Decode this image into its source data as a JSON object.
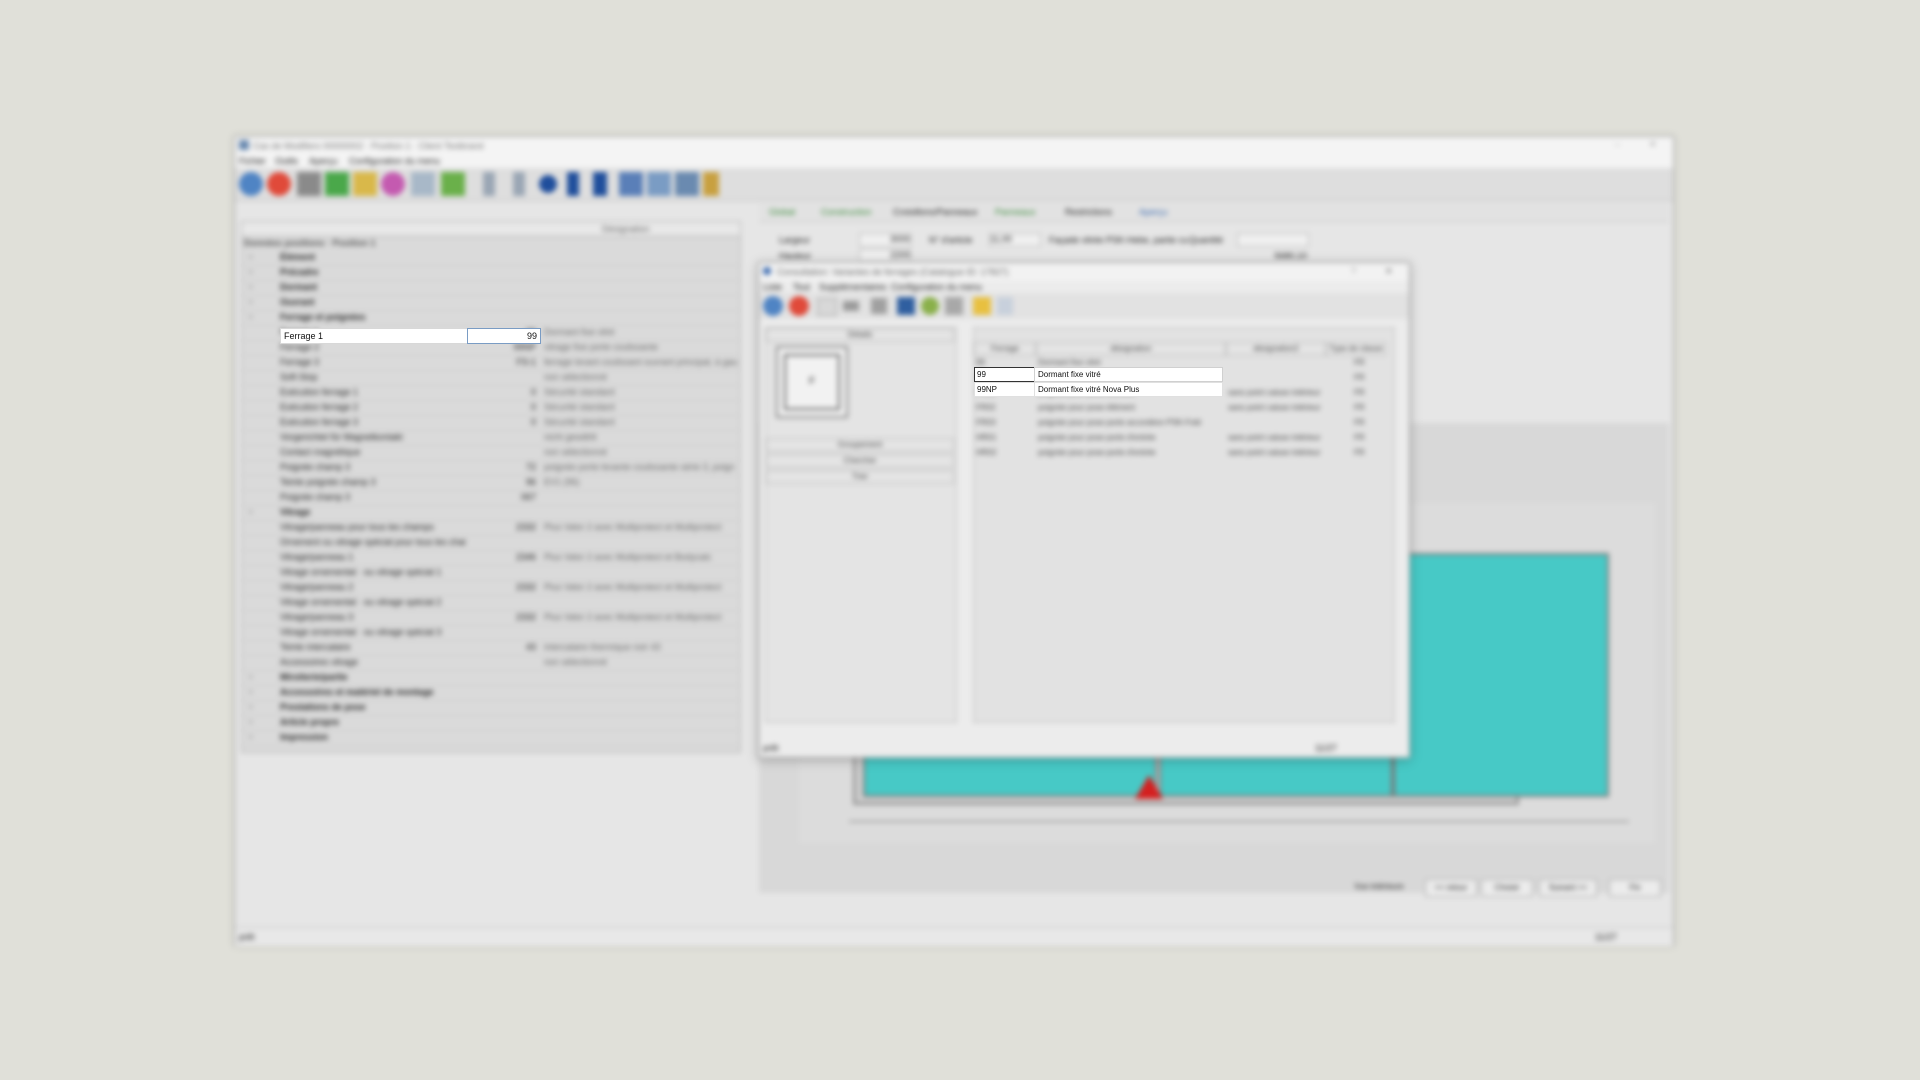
{
  "titlebar": {
    "title": "Cas de Modifiers 00000002 · Position 1 · Client Testbrand"
  },
  "menu": [
    "Fichier",
    "Outils",
    "Aperçu",
    "Configuration du menu"
  ],
  "toolbar_icons": [
    "blue-globe-icon",
    "red-circle-icon",
    "hammer-icon",
    "arrow-green-icon",
    "pencil-icon",
    "palette-icon",
    "copy-icon",
    "tree-icon",
    "first-icon",
    "prev-icon",
    "record-icon",
    "next-icon",
    "last-icon",
    "window-icon",
    "image-icon",
    "grid-icon",
    "key-icon"
  ],
  "left": {
    "header": {
      "col3": "Désignation"
    },
    "group_title": "Données positions · Position 1",
    "rows": [
      {
        "label": "Élément",
        "value": "",
        "desc": "",
        "group": true
      },
      {
        "label": "Précadre",
        "value": "",
        "desc": "",
        "group": true
      },
      {
        "label": "Dormant",
        "value": "",
        "desc": "",
        "group": true
      },
      {
        "label": "Ouvrant",
        "value": "",
        "desc": "",
        "group": true
      },
      {
        "label": "Ferrage et poignées",
        "value": "",
        "desc": "",
        "group": true
      },
      {
        "label": "Ferrage 1",
        "value": "99",
        "desc": "Dormant fixe vitré",
        "group": false
      },
      {
        "label": "Ferrage 2",
        "value": "99NP",
        "desc": "vitrage fixe porte coulissante",
        "group": false
      },
      {
        "label": "Ferrage 3",
        "value": "FS-1",
        "desc": "ferrage levant coulissant ouvrant principal, à gau",
        "group": false
      },
      {
        "label": "Soft-Stop",
        "value": "",
        "desc": "non sélectionné",
        "group": false
      },
      {
        "label": "Exécution ferrage 1",
        "value": "0",
        "desc": "Sécurité standard",
        "group": false
      },
      {
        "label": "Exécution ferrage 2",
        "value": "0",
        "desc": "Sécurité standard",
        "group": false
      },
      {
        "label": "Exécution ferrage 3",
        "value": "0",
        "desc": "Sécurité standard",
        "group": false
      },
      {
        "label": "Vorgerichtet für Magnetkontakt",
        "value": "",
        "desc": "nicht gewählt",
        "group": false
      },
      {
        "label": "Contact magnétique",
        "value": "",
        "desc": "non sélectionné",
        "group": false
      },
      {
        "label": "Poignée champ 3",
        "value": "72",
        "desc": "poignée porte levante coulissante série 3, poign",
        "group": false
      },
      {
        "label": "Teinte poignée champ 3",
        "value": "96",
        "desc": "EV1 (96)",
        "group": false
      },
      {
        "label": "Poignée champ 3",
        "value": "067",
        "desc": "",
        "group": false
      },
      {
        "label": "Vitrage",
        "value": "",
        "desc": "",
        "group": true
      },
      {
        "label": "Vitrage/panneau pour tous les champs",
        "value": "2332",
        "desc": "Plus Valor 2 avec Multiprotect et Multiprotect",
        "group": false
      },
      {
        "label": "Ornement ou vitrage spécial pour tous les chain",
        "value": "",
        "desc": "",
        "group": false
      },
      {
        "label": "Vitrage/panneau 1",
        "value": "2346",
        "desc": "Plus Valor 2 avec Multiprotect et Bodycalc",
        "group": false
      },
      {
        "label": "Vitrage ornemental · ou vitrage spécial 1",
        "value": "",
        "desc": "",
        "group": false
      },
      {
        "label": "Vitrage/panneau 2",
        "value": "2332",
        "desc": "Plus Valor 2 avec Multiprotect et Multiprotect",
        "group": false
      },
      {
        "label": "Vitrage ornemental · ou vitrage spécial 2",
        "value": "",
        "desc": "",
        "group": false
      },
      {
        "label": "Vitrage/panneau 3",
        "value": "2332",
        "desc": "Plus Valor 2 avec Multiprotect et Multiprotect",
        "group": false
      },
      {
        "label": "Vitrage ornemental · ou vitrage spécial 3",
        "value": "",
        "desc": "",
        "group": false
      },
      {
        "label": "Teinte intercalaire",
        "value": "43",
        "desc": "intercalaire thermique noir 43",
        "group": false
      },
      {
        "label": "Accessoires vitrage",
        "value": "",
        "desc": "non sélectionné",
        "group": false
      },
      {
        "label": "Miroiterie/partie",
        "value": "",
        "desc": "",
        "group": true
      },
      {
        "label": "Accessoires et matériel de montage",
        "value": "",
        "desc": "",
        "group": true
      },
      {
        "label": "Prestations de pose",
        "value": "",
        "desc": "",
        "group": true
      },
      {
        "label": "Article propre",
        "value": "",
        "desc": "",
        "group": true
      },
      {
        "label": "Impression",
        "value": "",
        "desc": "",
        "group": true
      }
    ]
  },
  "right": {
    "tabs": [
      "Global",
      "Construction",
      "Croisillons/Panneaux",
      "Panneaux",
      "Restrictions",
      "Aperçu"
    ],
    "fields": [
      {
        "label": "Largeur",
        "value": "3000"
      },
      {
        "label": "Hauteur",
        "value": "2200"
      },
      {
        "label": "N° d'article",
        "value": "11,00"
      },
      {
        "label": "Quantité",
        "value": ""
      }
    ],
    "desc_text": "Façade vitrée PSK-Hebe, partie cu",
    "price": "5680,10"
  },
  "dialog": {
    "title": "Consultation: Variantes de ferrages (Catalogue ID: 17827)",
    "menu": [
      "Liste",
      "Tout",
      "Supplémentaires",
      "Configuration du menu"
    ],
    "left_header": "Détails",
    "left_items": [
      "Groupement",
      "Chercher",
      "Trier"
    ],
    "preview_letter": "F",
    "columns": [
      "Ferrage",
      "désignation",
      "désignation2",
      "Type de classe"
    ],
    "rows": [
      {
        "code": "99",
        "name": "Dormant fixe vitré",
        "name2": "",
        "type": "FR"
      },
      {
        "code": "99NP",
        "name": "Dormant fixe vitré Nova Plus",
        "name2": "",
        "type": "FR"
      },
      {
        "code": "FR01",
        "name": "poignée pour pose élément",
        "name2": "sans point caisse intérieur",
        "type": "FR"
      },
      {
        "code": "FR02",
        "name": "poignée pour pose élément",
        "name2": "sans point caisse intérieur",
        "type": "FR"
      },
      {
        "code": "FR03",
        "name": "poignée pour pose porte accordéon PSK-Fold",
        "name2": "",
        "type": "FR"
      },
      {
        "code": "HR01",
        "name": "poignée pour pose porte d'entrée",
        "name2": "sans point caisse intérieur",
        "type": "FR"
      },
      {
        "code": "HR02",
        "name": "poignée pour pose porte d'entrée",
        "name2": "sans point caisse intérieur",
        "type": "FR"
      }
    ],
    "status_left": "prêt",
    "status_right": "11/27"
  },
  "buttons": [
    "Vue intérieure",
    "<< retour",
    "Choisir",
    "Suivant >>",
    "Fin"
  ],
  "statusbar": {
    "left": "prêt",
    "right": "11/27"
  },
  "colors": {
    "glass": "#47c9c6",
    "background": "#e0e0d9",
    "highlight": "#ffffff"
  }
}
